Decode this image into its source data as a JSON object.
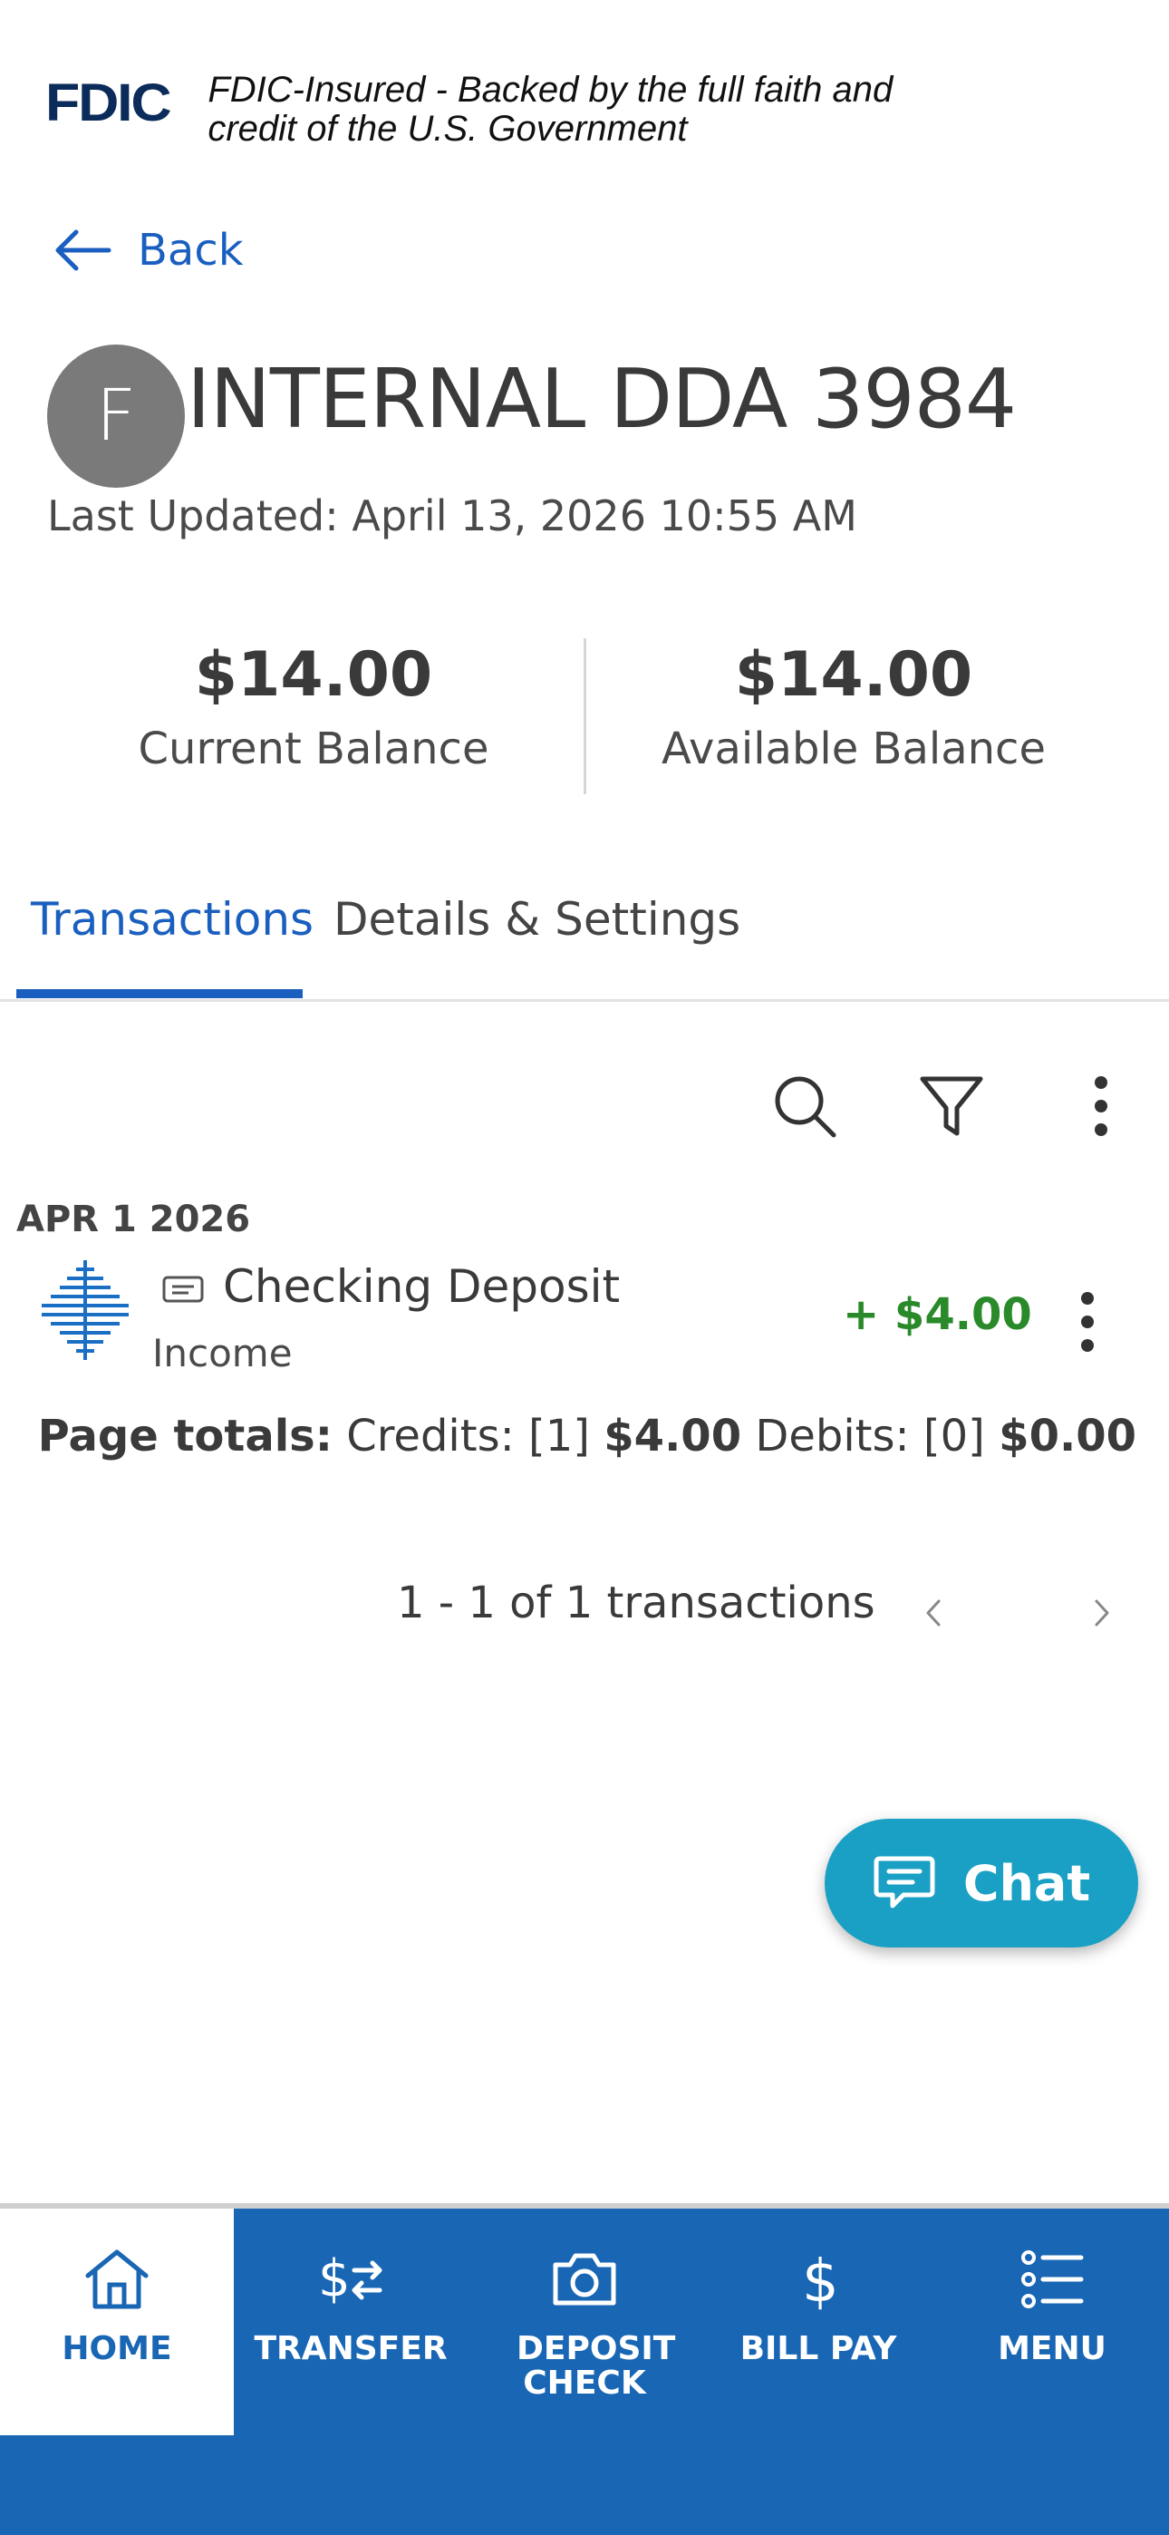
{
  "fdic": {
    "logo": "FDIC",
    "text": "FDIC-Insured - Backed by the full faith and credit of the U.S. Government"
  },
  "back": {
    "label": "Back",
    "icon": "arrow-left-icon"
  },
  "account": {
    "avatar_letter": "F",
    "name": "INTERNAL DDA 3984",
    "last_updated": "Last Updated: April 13, 2026 10:55 AM",
    "current_balance": "$14.00",
    "current_balance_label": "Current Balance",
    "available_balance": "$14.00",
    "available_balance_label": "Available Balance"
  },
  "tabs": [
    {
      "label": "Transactions",
      "active": true
    },
    {
      "label": "Details & Settings",
      "active": false
    }
  ],
  "toolbar": {
    "icons": [
      "search-icon",
      "filter-icon",
      "more-vertical-icon"
    ]
  },
  "transactions": {
    "groups": [
      {
        "date": "APR 1 2026",
        "items": [
          {
            "description": "Checking Deposit",
            "category": "Income",
            "amount": "+ $4.00",
            "type_icon": "check-icon"
          }
        ]
      }
    ],
    "totals": {
      "label": "Page totals:",
      "credits_label": "Credits: [1]",
      "credits_amount": "$4.00",
      "debits_label": "Debits: [0]",
      "debits_amount": "$0.00"
    },
    "pagination": "1 - 1 of 1 transactions"
  },
  "chat": {
    "label": "Chat",
    "icon": "chat-bubble-icon"
  },
  "nav": [
    {
      "label": "HOME",
      "icon": "home-icon",
      "active": true
    },
    {
      "label": "TRANSFER",
      "icon": "transfer-icon",
      "active": false
    },
    {
      "label": "DEPOSIT CHECK",
      "icon": "camera-icon",
      "active": false
    },
    {
      "label": "BILL PAY",
      "icon": "dollar-icon",
      "active": false
    },
    {
      "label": "MENU",
      "icon": "list-icon",
      "active": false
    }
  ],
  "colors": {
    "brand_blue": "#1866b4",
    "link_blue": "#1a5fbf",
    "credit_green": "#2a8a2a",
    "chat_teal": "#1aa0c4",
    "fdic_navy": "#0b2c5a"
  }
}
